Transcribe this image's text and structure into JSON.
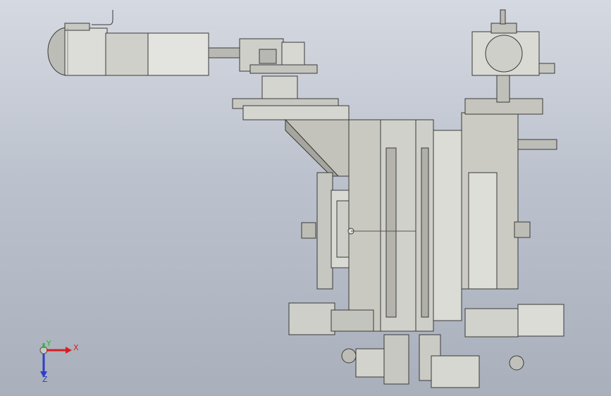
{
  "viewport": {
    "background_top": "#d5d9e1",
    "background_bottom": "#a9afbb"
  },
  "triad": {
    "x_label": "X",
    "y_label": "Y",
    "z_label": "Z",
    "x_color": "#d42020",
    "y_color": "#2fb72f",
    "z_color": "#2f3ec8"
  },
  "model": {
    "part_fill": "#c8c8c2",
    "part_dark": "#8e8e86",
    "part_light": "#e6e6e0",
    "motor_fill": "#d9d9d6"
  }
}
